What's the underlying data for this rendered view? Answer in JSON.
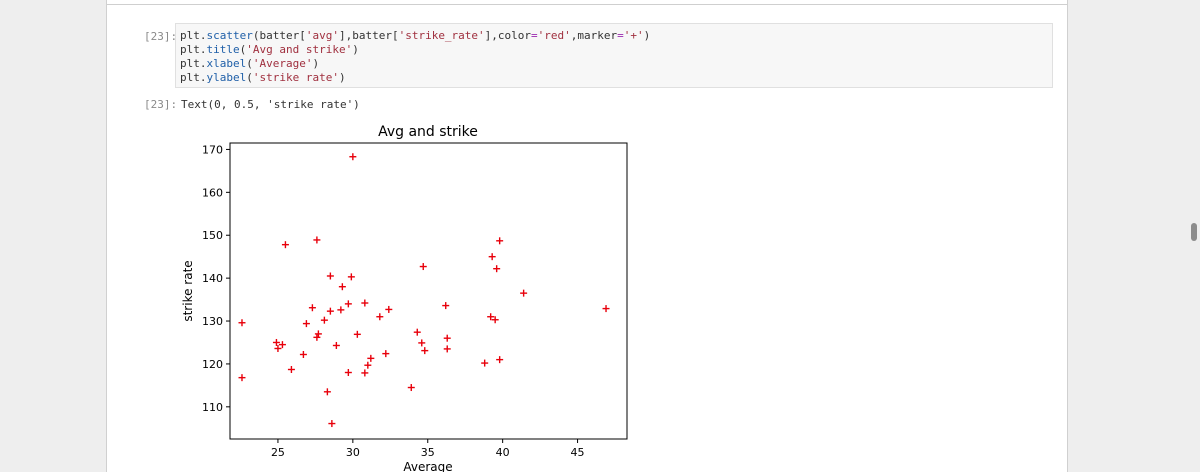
{
  "cell": {
    "input_prompt": "[23]:",
    "output_prompt": "[23]:",
    "code": {
      "l1": {
        "a": "plt.",
        "b": "scatter",
        "c": "(batter[",
        "d": "'avg'",
        "e": "],batter[",
        "f": "'strike_rate'",
        "g": "],color",
        "h": "=",
        "i": "'red'",
        "j": ",marker",
        "k": "=",
        "l": "'+'",
        "m": ")"
      },
      "l2": {
        "a": "plt.",
        "b": "title",
        "c": "(",
        "d": "'Avg and strike'",
        "e": ")"
      },
      "l3": {
        "a": "plt.",
        "b": "xlabel",
        "c": "(",
        "d": "'Average'",
        "e": ")"
      },
      "l4": {
        "a": "plt.",
        "b": "ylabel",
        "c": "(",
        "d": "'strike rate'",
        "e": ")"
      }
    },
    "output_text": "Text(0, 0.5, 'strike rate')"
  },
  "colors": {
    "marker": "#e8000b",
    "axes": "#000000"
  },
  "chart_data": {
    "type": "scatter",
    "title": "Avg and strike",
    "xlabel": "Average",
    "ylabel": "strike rate",
    "marker": "+",
    "xlim": [
      21.8,
      48.3
    ],
    "ylim": [
      102.5,
      171.5
    ],
    "xticks": [
      25,
      30,
      35,
      40,
      45
    ],
    "yticks": [
      110,
      120,
      130,
      140,
      150,
      160,
      170
    ],
    "grid": false,
    "points": [
      [
        22.6,
        129.6
      ],
      [
        22.6,
        116.8
      ],
      [
        24.9,
        125.0
      ],
      [
        25.0,
        123.6
      ],
      [
        25.3,
        124.5
      ],
      [
        25.5,
        147.8
      ],
      [
        25.9,
        118.7
      ],
      [
        26.7,
        122.2
      ],
      [
        26.9,
        129.4
      ],
      [
        27.3,
        133.1
      ],
      [
        27.6,
        126.2
      ],
      [
        27.7,
        127.0
      ],
      [
        27.6,
        148.9
      ],
      [
        28.1,
        130.2
      ],
      [
        28.3,
        113.5
      ],
      [
        28.5,
        140.5
      ],
      [
        28.5,
        132.3
      ],
      [
        28.6,
        106.1
      ],
      [
        28.9,
        124.3
      ],
      [
        29.2,
        132.6
      ],
      [
        29.3,
        138.0
      ],
      [
        29.7,
        118.0
      ],
      [
        29.7,
        134.0
      ],
      [
        29.9,
        140.3
      ],
      [
        30.0,
        168.3
      ],
      [
        30.3,
        126.9
      ],
      [
        30.8,
        117.9
      ],
      [
        30.8,
        134.2
      ],
      [
        31.0,
        119.7
      ],
      [
        31.2,
        121.3
      ],
      [
        31.8,
        131.0
      ],
      [
        32.2,
        122.4
      ],
      [
        32.4,
        132.7
      ],
      [
        33.9,
        114.5
      ],
      [
        34.3,
        127.4
      ],
      [
        34.6,
        124.9
      ],
      [
        34.8,
        123.1
      ],
      [
        34.7,
        142.7
      ],
      [
        36.2,
        133.6
      ],
      [
        36.3,
        126.0
      ],
      [
        36.3,
        123.5
      ],
      [
        38.8,
        120.2
      ],
      [
        39.2,
        131.0
      ],
      [
        39.5,
        130.3
      ],
      [
        39.3,
        145.0
      ],
      [
        39.6,
        142.2
      ],
      [
        39.8,
        148.7
      ],
      [
        39.8,
        121.0
      ],
      [
        41.4,
        136.5
      ],
      [
        46.9,
        132.9
      ]
    ]
  }
}
